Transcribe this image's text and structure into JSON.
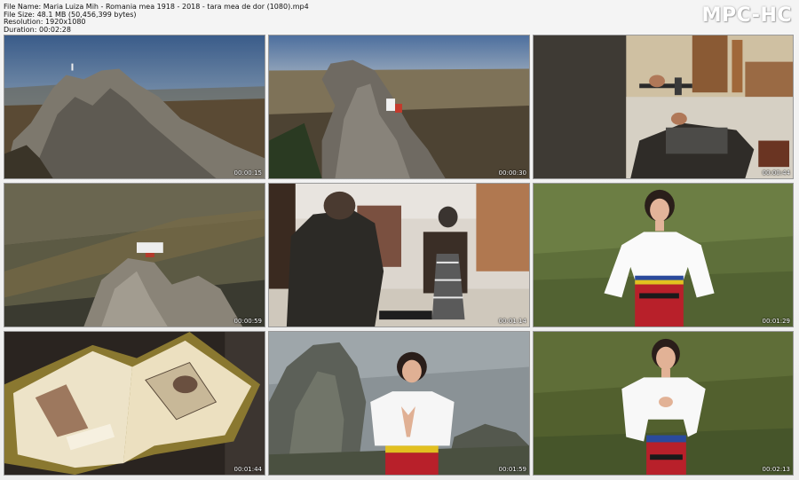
{
  "file_info": {
    "file_name": "File Name: Maria Luiza Mih - Romania mea 1918 - 2018 - tara mea de dor (1080).mp4",
    "file_size": "File Size: 48.1 MB (50,456,399 bytes)",
    "resolution": "Resolution: 1920x1080",
    "duration": "Duration: 00:02:28"
  },
  "logo": "MPC-HC",
  "thumbnails": [
    {
      "timestamp": "00:00:15",
      "scene": "mountain-peak-aerial"
    },
    {
      "timestamp": "00:00:30",
      "scene": "rock-outcrop-sitting-figure"
    },
    {
      "timestamp": "00:00:44",
      "scene": "craftsman-hammering"
    },
    {
      "timestamp": "00:00:59",
      "scene": "aerial-rock-dancers"
    },
    {
      "timestamp": "00:01:14",
      "scene": "workshop-boy-and-man"
    },
    {
      "timestamp": "00:01:29",
      "scene": "singer-traditional-dress-grass"
    },
    {
      "timestamp": "00:01:44",
      "scene": "open-illustrated-book"
    },
    {
      "timestamp": "00:01:59",
      "scene": "singer-praying-rocks"
    },
    {
      "timestamp": "00:02:13",
      "scene": "singer-hand-on-heart"
    }
  ]
}
